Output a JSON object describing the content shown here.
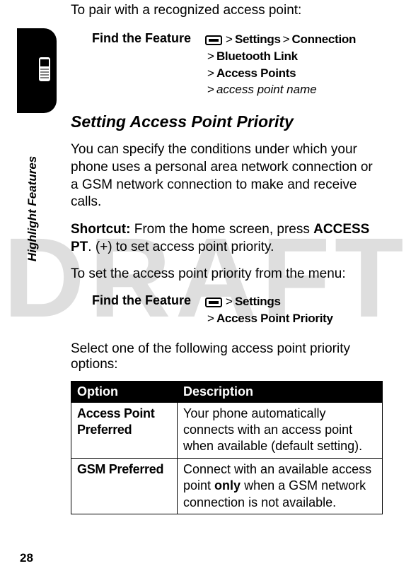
{
  "watermark": "DRAFT",
  "side_label": "Highlight Features",
  "page_number": "28",
  "intro": "To pair with a recognized access point:",
  "find1": {
    "label": "Find the Feature",
    "path": {
      "l1a": "Settings",
      "l1b": "Connection",
      "l2": "Bluetooth Link",
      "l3": "Access Points",
      "l4": "access point name"
    }
  },
  "heading": "Setting Access Point Priority",
  "para1": "You can specify the conditions under which your phone uses a personal area network connection or a GSM network connection to make and receive calls.",
  "para2_pre": "Shortcut:",
  "para2_mid": " From the home screen, press ",
  "para2_key": "ACCESS PT",
  "para2_plus": ". (",
  "para2_plus2": "+",
  "para2_post": ") to set access point priority.",
  "para3": "To set the access point priority from the menu:",
  "find2": {
    "label": "Find the Feature",
    "path": {
      "l1": "Settings",
      "l2": "Access Point Priority"
    }
  },
  "select_intro": "Select one of the following access point priority options:",
  "table": {
    "h1": "Option",
    "h2": "Description",
    "rows": [
      {
        "opt": "Access Point Preferred",
        "desc": "Your phone automatically connects with an access point when available (default setting)."
      },
      {
        "opt": "GSM Preferred",
        "desc_pre": "Connect with an available access point ",
        "desc_bold": "only",
        "desc_post": " when a GSM network connection is not available."
      }
    ]
  }
}
